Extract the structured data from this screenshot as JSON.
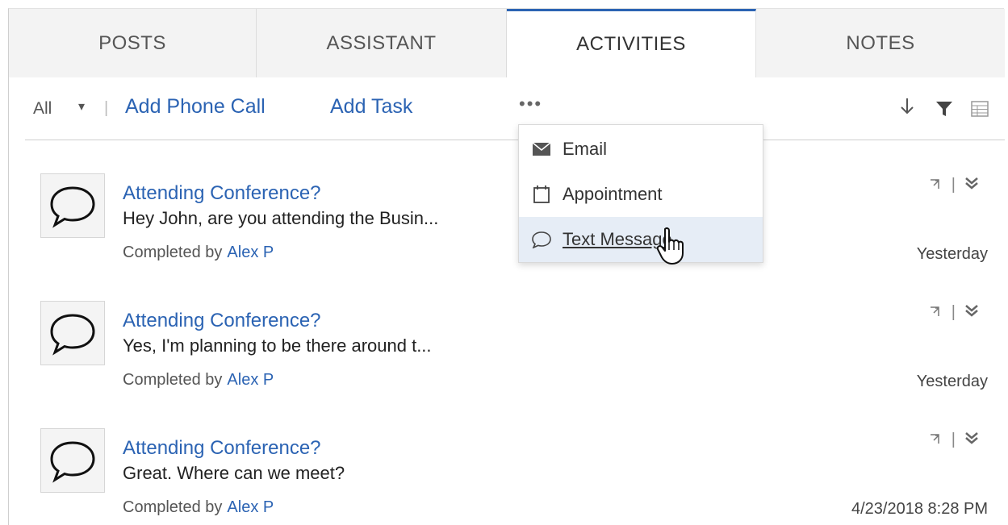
{
  "tabs": [
    {
      "label": "POSTS"
    },
    {
      "label": "ASSISTANT"
    },
    {
      "label": "ACTIVITIES"
    },
    {
      "label": "NOTES"
    }
  ],
  "toolbar": {
    "filter_value": "All",
    "add_phone_call": "Add Phone Call",
    "add_task": "Add Task",
    "more": "•••"
  },
  "menu": {
    "items": [
      {
        "label": "Email",
        "icon": "envelope-icon"
      },
      {
        "label": "Appointment",
        "icon": "calendar-icon"
      },
      {
        "label": "Text Message",
        "icon": "chat-bubble-icon"
      }
    ]
  },
  "activities": [
    {
      "title": "Attending Conference?",
      "snippet": "Hey John, are you attending the Busin...",
      "completed_label": "Completed by",
      "completed_by": "Alex P",
      "date": "Yesterday"
    },
    {
      "title": "Attending Conference?",
      "snippet": "Yes, I'm planning to be there around t...",
      "completed_label": "Completed by",
      "completed_by": "Alex P",
      "date": "Yesterday"
    },
    {
      "title": "Attending Conference?",
      "snippet": "Great. Where can we meet?",
      "completed_label": "Completed by",
      "completed_by": "Alex P",
      "date": "4/23/2018 8:28 PM"
    }
  ],
  "colors": {
    "accent": "#2b63b3",
    "tab_bg": "#f3f3f3",
    "menu_hover": "#e6edf6"
  }
}
